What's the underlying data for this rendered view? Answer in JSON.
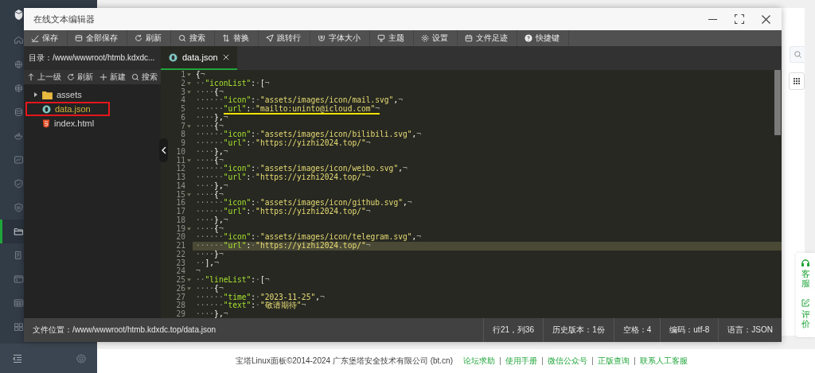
{
  "sidebar": {
    "items": [
      {
        "selected": false
      },
      {
        "selected": false
      },
      {
        "selected": false
      },
      {
        "selected": false
      },
      {
        "selected": false
      },
      {
        "selected": false
      },
      {
        "selected": false
      },
      {
        "selected": false
      },
      {
        "selected": true
      },
      {
        "selected": false
      },
      {
        "selected": false
      },
      {
        "selected": false
      },
      {
        "selected": false
      }
    ]
  },
  "dialog": {
    "title": "在线文本编辑器",
    "toolbar": [
      "保存",
      "全部保存",
      "刷新",
      "搜索",
      "替换",
      "跳转行",
      "字体大小",
      "主题",
      "设置",
      "文件足迹",
      "快捷键"
    ],
    "directory": {
      "path": "目录：/www/wwwroot/htmb.kdxdc...",
      "actions": [
        "上一级",
        "刷新",
        "新建",
        "搜索"
      ]
    },
    "tree": [
      {
        "name": "assets",
        "kind": "folder",
        "expanded": false,
        "selected": false,
        "highlighted": false
      },
      {
        "name": "data.json",
        "kind": "json",
        "selected": true,
        "highlighted": true
      },
      {
        "name": "index.html",
        "kind": "html",
        "selected": false,
        "highlighted": false
      }
    ],
    "tabs": [
      {
        "label": "data.json",
        "selected": true
      }
    ],
    "lines": [
      {
        "number": "1",
        "text": "{¬",
        "fold": true,
        "current": false,
        "underlined": false
      },
      {
        "number": "2",
        "text": "··\"iconList\":·[¬",
        "fold": true,
        "current": false,
        "underlined": false
      },
      {
        "number": "3",
        "text": "····{¬",
        "fold": true,
        "current": false,
        "underlined": false
      },
      {
        "number": "4",
        "text": "······\"icon\":·\"assets/images/icon/mail.svg\",¬",
        "fold": false,
        "current": false,
        "underlined": false
      },
      {
        "number": "5",
        "text": "······\"url\":·\"mailto:uninto@icloud.com\"¬",
        "fold": false,
        "current": false,
        "underlined": true
      },
      {
        "number": "6",
        "text": "····},¬",
        "fold": false,
        "current": false,
        "underlined": false
      },
      {
        "number": "7",
        "text": "····{¬",
        "fold": true,
        "current": false,
        "underlined": false
      },
      {
        "number": "8",
        "text": "······\"icon\":·\"assets/images/icon/bilibili.svg\",¬",
        "fold": false,
        "current": false,
        "underlined": false
      },
      {
        "number": "9",
        "text": "······\"url\":·\"https://yizhi2024.top/\"¬",
        "fold": false,
        "current": false,
        "underlined": false
      },
      {
        "number": "10",
        "text": "····},¬",
        "fold": false,
        "current": false,
        "underlined": false
      },
      {
        "number": "11",
        "text": "····{¬",
        "fold": true,
        "current": false,
        "underlined": false
      },
      {
        "number": "12",
        "text": "······\"icon\":·\"assets/images/icon/weibo.svg\",¬",
        "fold": false,
        "current": false,
        "underlined": false
      },
      {
        "number": "13",
        "text": "······\"url\":·\"https://yizhi2024.top/\"¬",
        "fold": false,
        "current": false,
        "underlined": false
      },
      {
        "number": "14",
        "text": "····},¬",
        "fold": false,
        "current": false,
        "underlined": false
      },
      {
        "number": "15",
        "text": "····{¬",
        "fold": true,
        "current": false,
        "underlined": false
      },
      {
        "number": "16",
        "text": "······\"icon\":·\"assets/images/icon/github.svg\",¬",
        "fold": false,
        "current": false,
        "underlined": false
      },
      {
        "number": "17",
        "text": "······\"url\":·\"https://yizhi2024.top/\"¬",
        "fold": false,
        "current": false,
        "underlined": false
      },
      {
        "number": "18",
        "text": "····},¬",
        "fold": false,
        "current": false,
        "underlined": false
      },
      {
        "number": "19",
        "text": "····{¬",
        "fold": true,
        "current": false,
        "underlined": false
      },
      {
        "number": "20",
        "text": "······\"icon\":·\"assets/images/icon/telegram.svg\",¬",
        "fold": false,
        "current": false,
        "underlined": false
      },
      {
        "number": "21",
        "text": "······\"url\":·\"https://yizhi2024.top/\"¬",
        "fold": false,
        "current": true,
        "underlined": false
      },
      {
        "number": "22",
        "text": "····}¬",
        "fold": false,
        "current": false,
        "underlined": false
      },
      {
        "number": "23",
        "text": "··],¬",
        "fold": false,
        "current": false,
        "underlined": false
      },
      {
        "number": "24",
        "text": "¬",
        "fold": false,
        "current": false,
        "underlined": false
      },
      {
        "number": "25",
        "text": "··\"lineList\":·[¬",
        "fold": true,
        "current": false,
        "underlined": false
      },
      {
        "number": "26",
        "text": "····{¬",
        "fold": true,
        "current": false,
        "underlined": false
      },
      {
        "number": "27",
        "text": "······\"time\":·\"2023-11-25\",¬",
        "fold": false,
        "current": false,
        "underlined": false
      },
      {
        "number": "28",
        "text": "······\"text\":·\"敬请期待\"¬",
        "fold": false,
        "current": false,
        "underlined": false
      },
      {
        "number": "29",
        "text": "····},¬",
        "fold": false,
        "current": false,
        "underlined": false
      }
    ],
    "status_bar": {
      "file": "文件位置：/www/wwwroot/htmb.kdxdc.top/data.json",
      "items": [
        "行21，列36",
        "历史版本：1份",
        "空格：4",
        "编码：utf-8",
        "语言：JSON"
      ]
    }
  },
  "float_panel": {
    "items": [
      "客服",
      "评价"
    ]
  },
  "footer": {
    "copyright": "宝塔Linux面板©2014-2024 广东堡塔安全技术有限公司 (bt.cn)",
    "links": [
      "论坛求助",
      "使用手册",
      "微信公众号",
      "正版查询",
      "联系人工客服"
    ]
  }
}
